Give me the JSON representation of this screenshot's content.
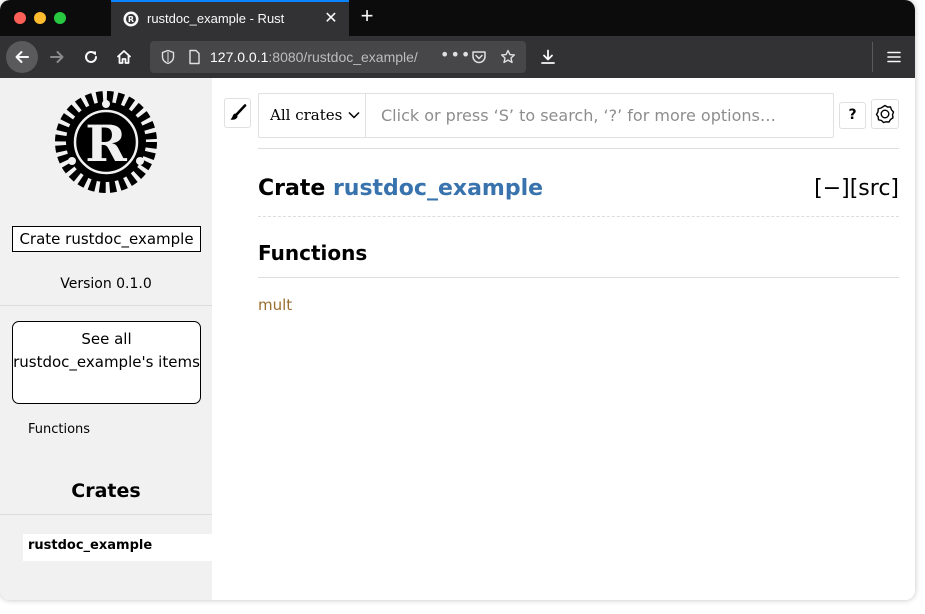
{
  "browser": {
    "tab_title": "rustdoc_example - Rust",
    "tab_close": "✕",
    "new_tab": "+",
    "url_host": "127.0.0.1",
    "url_rest": ":8080/rustdoc_example/",
    "more_dots": "•••"
  },
  "colors": {
    "accent_tab": "#0a84ff",
    "link": "#3873ad",
    "fn_link": "#9a6e31",
    "sidebar_bg": "#f1f1f1"
  },
  "sidebar": {
    "crate_label": "Crate rustdoc_example",
    "version": "Version 0.1.0",
    "see_all": "See all rustdoc_example's items",
    "functions_link": "Functions",
    "crates_heading": "Crates",
    "crate_item": "rustdoc_example"
  },
  "search": {
    "crate_filter": "All crates",
    "placeholder": "Click or press ‘S’ to search, ‘?’ for more options…",
    "help_label": "?"
  },
  "main": {
    "title_prefix": "Crate ",
    "title_link": "rustdoc_example",
    "toggle_src": "[−][src]",
    "section_heading": "Functions",
    "functions": [
      "mult"
    ]
  },
  "icons": [
    "rust-logo-icon",
    "back-arrow-icon",
    "forward-arrow-icon",
    "reload-icon",
    "home-icon",
    "shield-icon",
    "page-icon",
    "pocket-icon",
    "star-icon",
    "download-icon",
    "hamburger-menu-icon",
    "paintbrush-icon",
    "gear-icon",
    "chevron-down-icon"
  ]
}
